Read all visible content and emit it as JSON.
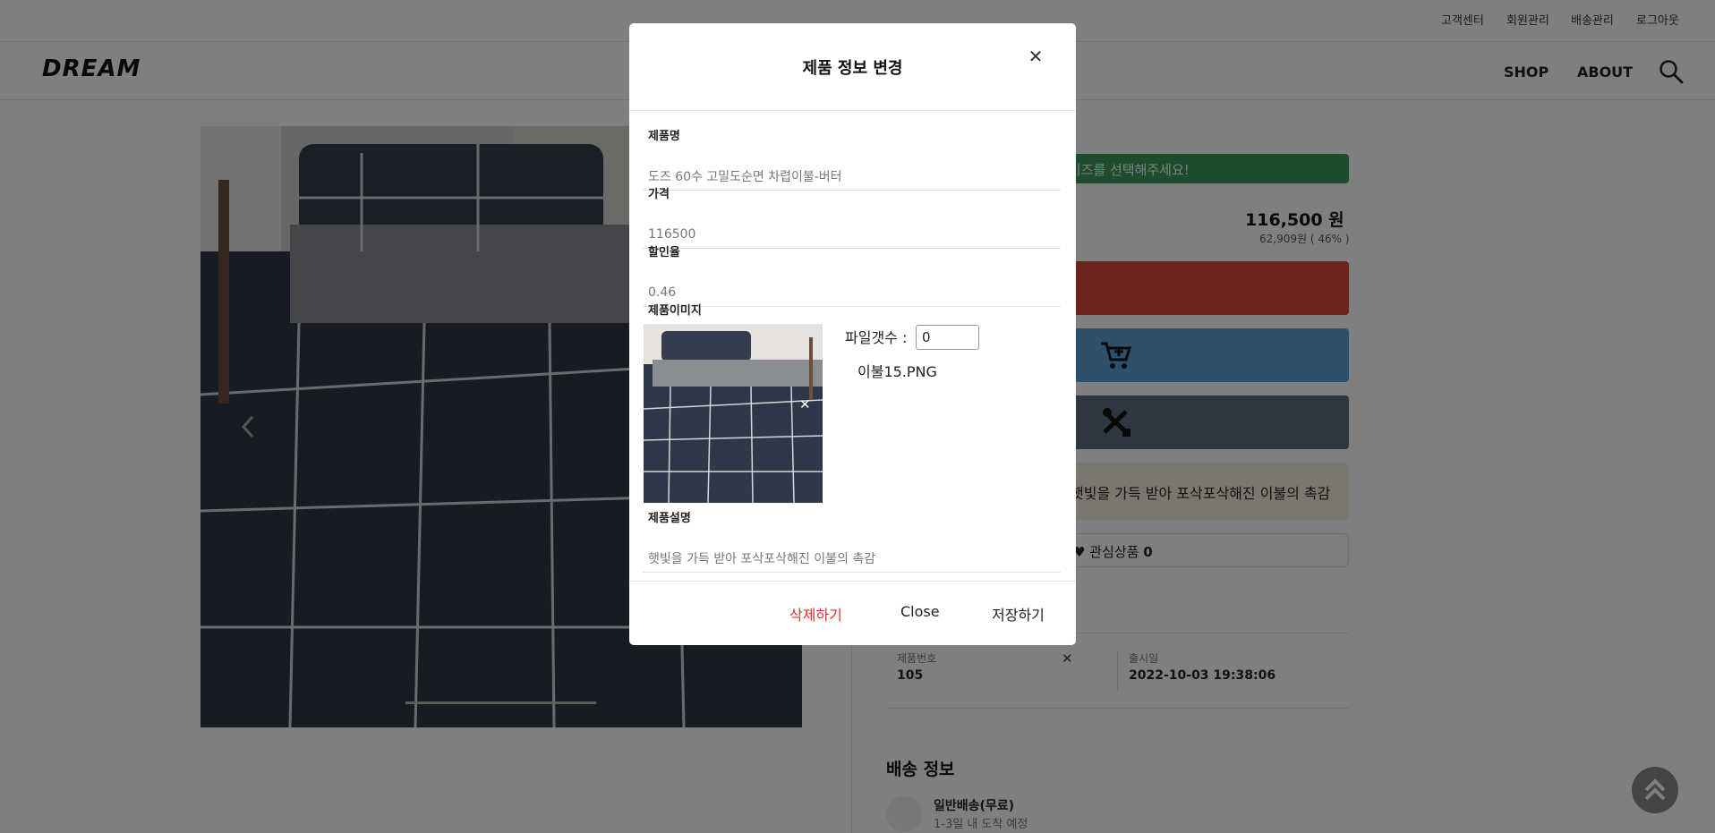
{
  "top_links": [
    "고객센터",
    "회원관리",
    "배송관리",
    "로그아웃"
  ],
  "header": {
    "logo": "DREAM",
    "nav": [
      "SHOP",
      "ABOUT"
    ]
  },
  "product": {
    "size_select": "사이즈를 선택해주세요!",
    "price": "116,500 원",
    "price_sub": "62,909원 ( 46% )",
    "description": "햇빛을 가득 받아 포삭포삭해진 이불의 촉감",
    "wishlist_label": "관심상품",
    "wishlist_count": "0",
    "info": {
      "number_label": "제품번호",
      "number_value": "105",
      "date_label": "출시일",
      "date_value": "2022-10-03 19:38:06"
    },
    "shipping": {
      "title": "배송 정보",
      "name": "일반배송(무료)",
      "eta": "1-3일 내 도착 예정"
    }
  },
  "modal": {
    "title": "제품 정보 변경",
    "fields": {
      "name_label": "제품명",
      "name_value": "도즈 60수 고밀도순면 차렵이불-버터",
      "price_label": "가격",
      "price_value": "116500",
      "discount_label": "할인율",
      "discount_value": "0.46",
      "image_label": "제품이미지",
      "desc_label": "제품설명",
      "desc_value": "햇빛을 가득 받아 포삭포삭해진 이불의 촉감"
    },
    "file_count_label": "파일갯수 :",
    "file_count_value": "0",
    "file_name": "이불15.PNG",
    "buttons": {
      "delete": "삭제하기",
      "close": "Close",
      "save": "저장하기"
    }
  },
  "colors": {
    "green": "#3a9b5a",
    "red": "#d84b3c",
    "blue": "#5aa0d9",
    "slate": "#5f6e87",
    "delete": "#e03030"
  }
}
